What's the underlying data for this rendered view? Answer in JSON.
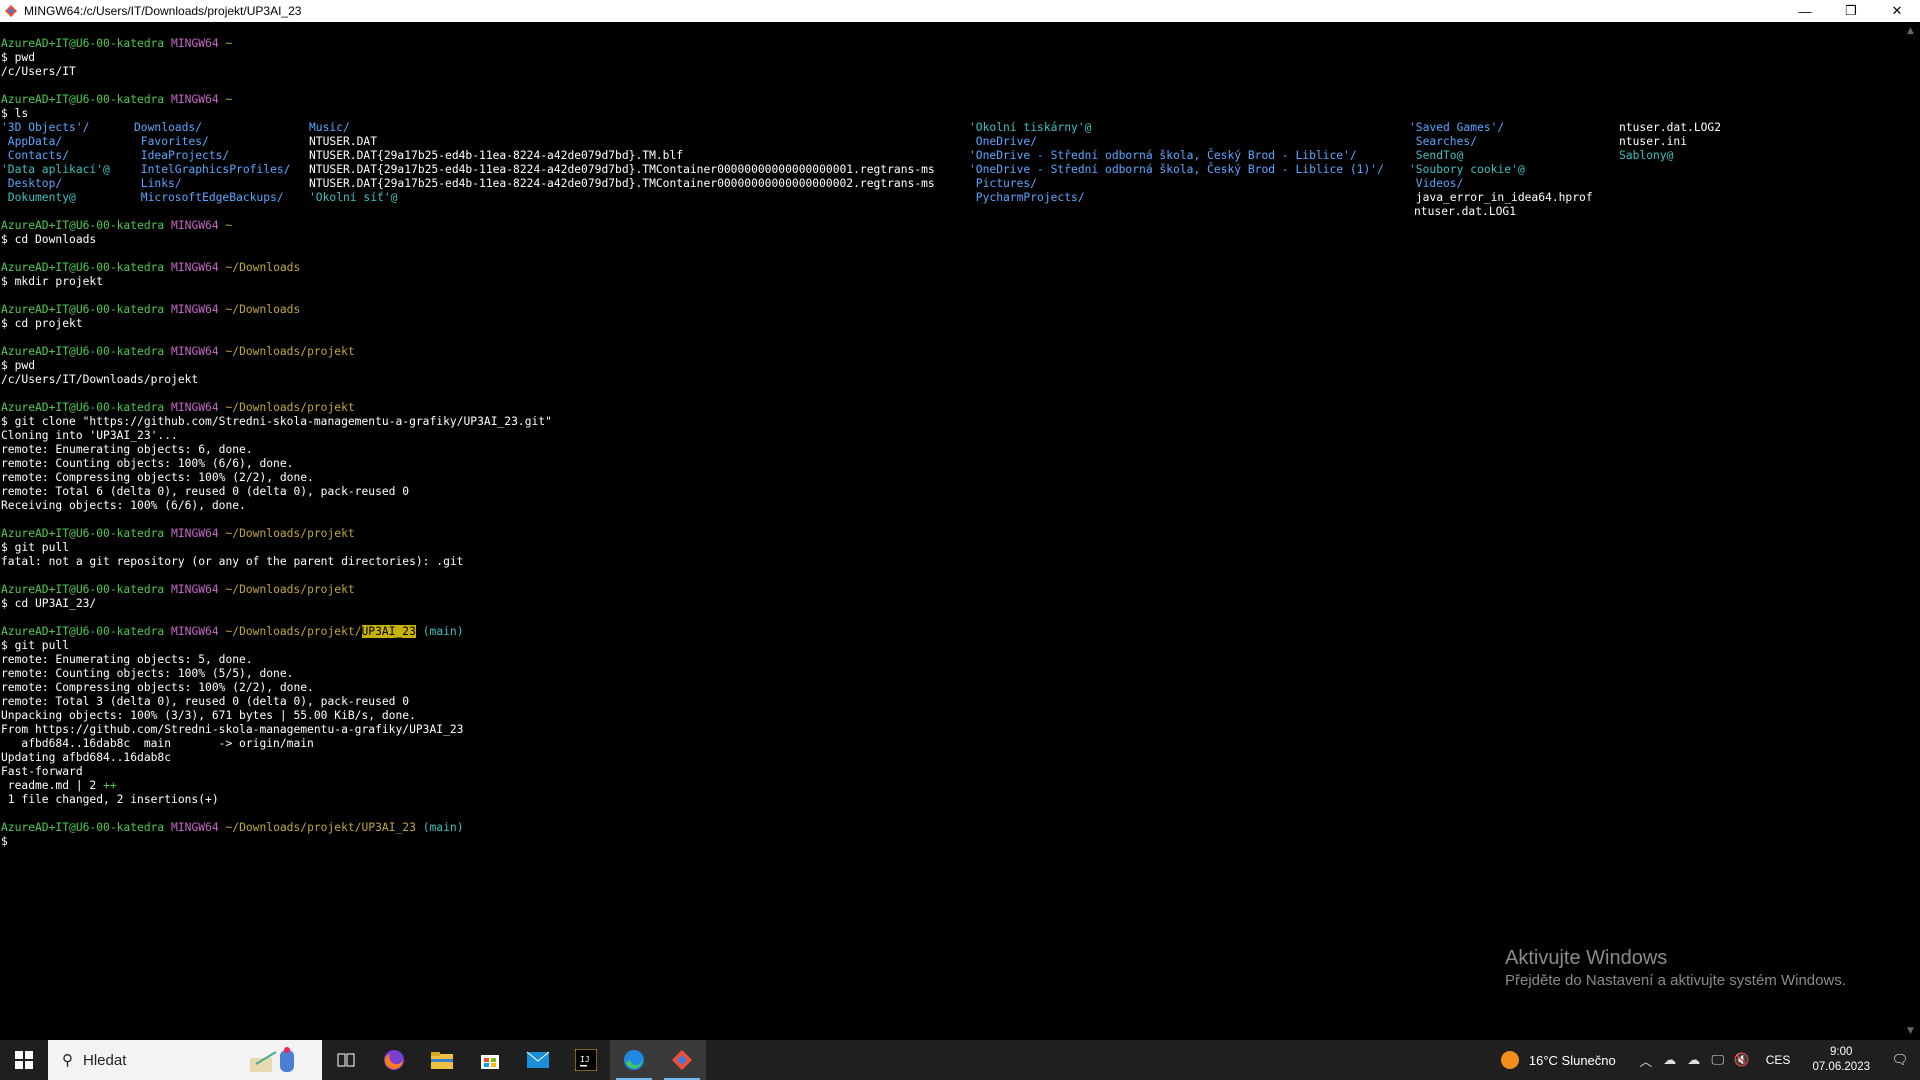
{
  "window": {
    "title": "MINGW64:/c/Users/IT/Downloads/projekt/UP3AI_23",
    "minimize": "—",
    "restore": "❐",
    "close": "✕"
  },
  "prompt": {
    "user": "AzureAD+IT@U6-00-katedra",
    "system": "MINGW64"
  },
  "terminal": {
    "lines": [
      {
        "type": "prompt",
        "path": "~"
      },
      {
        "type": "cmd",
        "text": "$ pwd"
      },
      {
        "type": "out",
        "text": "/c/Users/IT"
      },
      {
        "type": "blank"
      },
      {
        "type": "prompt",
        "path": "~"
      },
      {
        "type": "cmd",
        "text": "$ ls"
      },
      {
        "type": "ls",
        "row": 0
      },
      {
        "type": "ls",
        "row": 1
      },
      {
        "type": "ls",
        "row": 2
      },
      {
        "type": "ls",
        "row": 3
      },
      {
        "type": "ls",
        "row": 4
      },
      {
        "type": "ls",
        "row": 5
      },
      {
        "type": "blank"
      },
      {
        "type": "prompt",
        "path": "~"
      },
      {
        "type": "cmd",
        "text": "$ cd Downloads"
      },
      {
        "type": "blank"
      },
      {
        "type": "prompt",
        "path": "~/Downloads"
      },
      {
        "type": "cmd",
        "text": "$ mkdir projekt"
      },
      {
        "type": "blank"
      },
      {
        "type": "prompt",
        "path": "~/Downloads"
      },
      {
        "type": "cmd",
        "text": "$ cd projekt"
      },
      {
        "type": "blank"
      },
      {
        "type": "prompt",
        "path": "~/Downloads/projekt"
      },
      {
        "type": "cmd",
        "text": "$ pwd"
      },
      {
        "type": "out",
        "text": "/c/Users/IT/Downloads/projekt"
      },
      {
        "type": "blank"
      },
      {
        "type": "prompt",
        "path": "~/Downloads/projekt"
      },
      {
        "type": "cmd",
        "text": "$ git clone \"https://github.com/Stredni-skola-managementu-a-grafiky/UP3AI_23.git\""
      },
      {
        "type": "out",
        "text": "Cloning into 'UP3AI_23'..."
      },
      {
        "type": "out",
        "text": "remote: Enumerating objects: 6, done."
      },
      {
        "type": "out",
        "text": "remote: Counting objects: 100% (6/6), done."
      },
      {
        "type": "out",
        "text": "remote: Compressing objects: 100% (2/2), done."
      },
      {
        "type": "out",
        "text": "remote: Total 6 (delta 0), reused 0 (delta 0), pack-reused 0"
      },
      {
        "type": "out",
        "text": "Receiving objects: 100% (6/6), done."
      },
      {
        "type": "blank"
      },
      {
        "type": "prompt",
        "path": "~/Downloads/projekt"
      },
      {
        "type": "cmd",
        "text": "$ git pull"
      },
      {
        "type": "out",
        "text": "fatal: not a git repository (or any of the parent directories): .git"
      },
      {
        "type": "blank"
      },
      {
        "type": "prompt",
        "path": "~/Downloads/projekt"
      },
      {
        "type": "cmd",
        "text": "$ cd UP3AI_23/"
      },
      {
        "type": "blank"
      },
      {
        "type": "prompt",
        "path": "~/Downloads/projekt/",
        "highlight": "UP3AI_23",
        "branch": "(main)"
      },
      {
        "type": "cmd",
        "text": "$ git pull"
      },
      {
        "type": "out",
        "text": "remote: Enumerating objects: 5, done."
      },
      {
        "type": "out",
        "text": "remote: Counting objects: 100% (5/5), done."
      },
      {
        "type": "out",
        "text": "remote: Compressing objects: 100% (2/2), done."
      },
      {
        "type": "out",
        "text": "remote: Total 3 (delta 0), reused 0 (delta 0), pack-reused 0"
      },
      {
        "type": "out",
        "text": "Unpacking objects: 100% (3/3), 671 bytes | 55.00 KiB/s, done."
      },
      {
        "type": "out",
        "text": "From https://github.com/Stredni-skola-managementu-a-grafiky/UP3AI_23"
      },
      {
        "type": "out",
        "text": "   afbd684..16dab8c  main       -> origin/main"
      },
      {
        "type": "out",
        "text": "Updating afbd684..16dab8c"
      },
      {
        "type": "out",
        "text": "Fast-forward"
      },
      {
        "type": "diff",
        "text": " readme.md | 2 ",
        "plus": "++"
      },
      {
        "type": "out",
        "text": " 1 file changed, 2 insertions(+)"
      },
      {
        "type": "blank"
      },
      {
        "type": "prompt",
        "path": "~/Downloads/projekt/UP3AI_23",
        "branch": "(main)"
      },
      {
        "type": "cmd",
        "text": "$"
      }
    ],
    "ls_rows": [
      [
        "'3D Objects'/",
        "Downloads/",
        "Music/",
        "'Okolní tiskárny'@",
        "'Saved Games'/",
        "ntuser.dat.LOG2"
      ],
      [
        " AppData/",
        " Favorites/",
        "NTUSER.DAT",
        " OneDrive/",
        " Searches/",
        "ntuser.ini"
      ],
      [
        " Contacts/",
        " IdeaProjects/",
        "NTUSER.DAT{29a17b25-ed4b-11ea-8224-a42de079d7bd}.TM.blf",
        "'OneDrive - Střední odborná škola, Český Brod - Liblice'/",
        " SendTo@",
        "Sablony@"
      ],
      [
        "'Data aplikací'@",
        " IntelGraphicsProfiles/",
        "NTUSER.DAT{29a17b25-ed4b-11ea-8224-a42de079d7bd}.TMContainer00000000000000000001.regtrans-ms",
        "'OneDrive - Střední odborná škola, Český Brod - Liblice (1)'/",
        "'Soubory cookie'@",
        ""
      ],
      [
        " Desktop/",
        " Links/",
        "NTUSER.DAT{29a17b25-ed4b-11ea-8224-a42de079d7bd}.TMContainer00000000000000000002.regtrans-ms",
        " Pictures/",
        " Videos/",
        ""
      ],
      [
        " Dokumenty@",
        " MicrosoftEdgeBackups/",
        "'Okolní síť'@",
        " PycharmProjects/",
        " java_error_in_idea64.hprof",
        ""
      ],
      [
        "",
        "",
        "",
        "",
        "ntuser.dat.LOG1",
        ""
      ]
    ],
    "ls_colors": [
      [
        "blue",
        "blue",
        "blue",
        "cyan",
        "blue",
        "white"
      ],
      [
        "blue",
        "blue",
        "white",
        "blue",
        "blue",
        "white"
      ],
      [
        "blue",
        "blue",
        "white",
        "blue",
        "cyan",
        "cyan"
      ],
      [
        "cyan",
        "blue",
        "white",
        "blue",
        "cyan",
        "white"
      ],
      [
        "blue",
        "blue",
        "white",
        "blue",
        "blue",
        "white"
      ],
      [
        "cyan",
        "blue",
        "cyan",
        "blue",
        "white",
        "white"
      ],
      [
        "white",
        "white",
        "white",
        "white",
        "white",
        "white"
      ]
    ]
  },
  "watermark": {
    "heading": "Aktivujte Windows",
    "sub": "Přejděte do Nastavení a aktivujte systém Windows."
  },
  "taskbar": {
    "search_placeholder": "Hledat",
    "apps": [
      "task-view-icon",
      "firefox-icon",
      "file-explorer-icon",
      "store-icon",
      "mail-icon",
      "intellij-icon",
      "edge-icon",
      "git-bash-icon"
    ],
    "weather": "16°C  Slunečno",
    "lang": "CES",
    "time": "9:00",
    "date": "07.06.2023"
  }
}
